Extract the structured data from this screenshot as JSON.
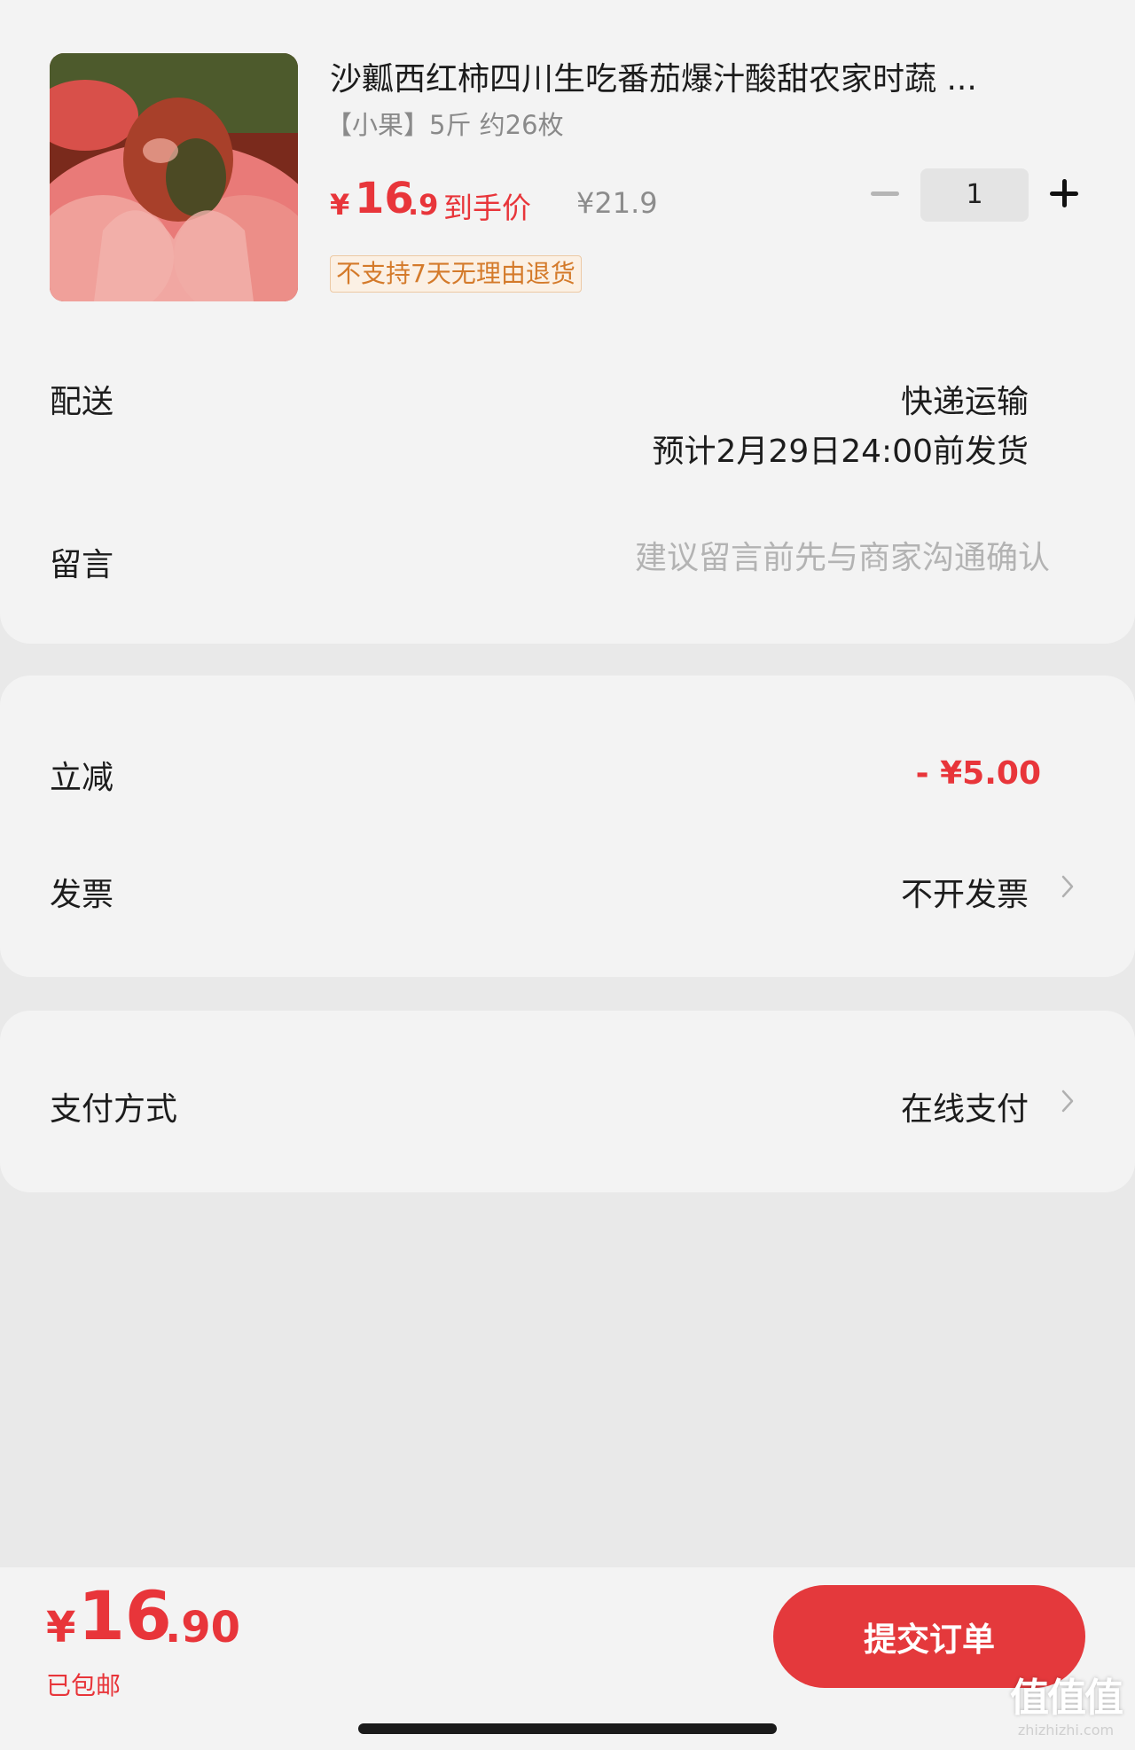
{
  "product": {
    "title": "沙瓤西红柿四川生吃番茄爆汁酸甜农家时蔬 ...",
    "spec": "【小果】5斤 约26枚",
    "price_symbol": "¥",
    "price_int": "16",
    "price_dec": ".9",
    "price_tag": "到手价",
    "original_price": "¥21.9",
    "quantity": "1",
    "return_policy": "不支持7天无理由退货",
    "image_icon": "tomato-image"
  },
  "delivery": {
    "label": "配送",
    "method": "快递运输",
    "eta": "预计2月29日24:00前发货"
  },
  "message": {
    "label": "留言",
    "placeholder": "建议留言前先与商家沟通确认"
  },
  "discount": {
    "label": "立减",
    "value": "- ¥5.00"
  },
  "invoice": {
    "label": "发票",
    "value": "不开发票"
  },
  "payment": {
    "label": "支付方式",
    "value": "在线支付"
  },
  "footer": {
    "total_symbol": "¥",
    "total_int": "16",
    "total_dec": ".90",
    "shipping_note": "已包邮",
    "submit_label": "提交订单"
  },
  "watermark": {
    "logo": "值值值",
    "url": "zhizhizhi.com"
  },
  "colors": {
    "accent": "#e4393c",
    "badge_text": "#d47a2a",
    "background": "#e9e9e9",
    "card": "#f3f3f3"
  }
}
